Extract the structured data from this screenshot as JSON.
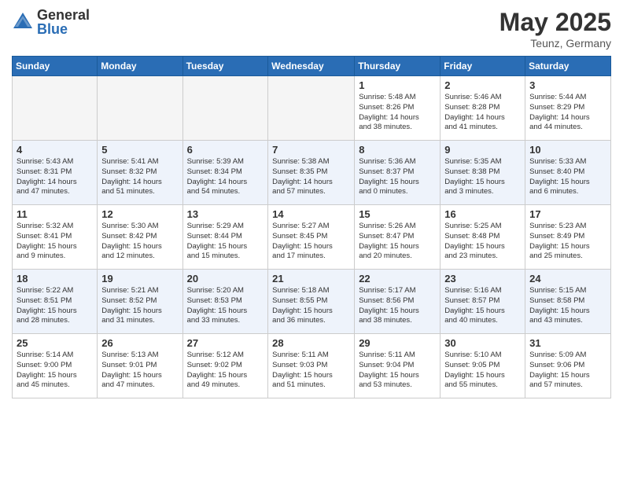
{
  "header": {
    "logo_general": "General",
    "logo_blue": "Blue",
    "month_title": "May 2025",
    "location": "Teunz, Germany"
  },
  "weekdays": [
    "Sunday",
    "Monday",
    "Tuesday",
    "Wednesday",
    "Thursday",
    "Friday",
    "Saturday"
  ],
  "weeks": [
    [
      {
        "day": "",
        "info": ""
      },
      {
        "day": "",
        "info": ""
      },
      {
        "day": "",
        "info": ""
      },
      {
        "day": "",
        "info": ""
      },
      {
        "day": "1",
        "info": "Sunrise: 5:48 AM\nSunset: 8:26 PM\nDaylight: 14 hours\nand 38 minutes."
      },
      {
        "day": "2",
        "info": "Sunrise: 5:46 AM\nSunset: 8:28 PM\nDaylight: 14 hours\nand 41 minutes."
      },
      {
        "day": "3",
        "info": "Sunrise: 5:44 AM\nSunset: 8:29 PM\nDaylight: 14 hours\nand 44 minutes."
      }
    ],
    [
      {
        "day": "4",
        "info": "Sunrise: 5:43 AM\nSunset: 8:31 PM\nDaylight: 14 hours\nand 47 minutes."
      },
      {
        "day": "5",
        "info": "Sunrise: 5:41 AM\nSunset: 8:32 PM\nDaylight: 14 hours\nand 51 minutes."
      },
      {
        "day": "6",
        "info": "Sunrise: 5:39 AM\nSunset: 8:34 PM\nDaylight: 14 hours\nand 54 minutes."
      },
      {
        "day": "7",
        "info": "Sunrise: 5:38 AM\nSunset: 8:35 PM\nDaylight: 14 hours\nand 57 minutes."
      },
      {
        "day": "8",
        "info": "Sunrise: 5:36 AM\nSunset: 8:37 PM\nDaylight: 15 hours\nand 0 minutes."
      },
      {
        "day": "9",
        "info": "Sunrise: 5:35 AM\nSunset: 8:38 PM\nDaylight: 15 hours\nand 3 minutes."
      },
      {
        "day": "10",
        "info": "Sunrise: 5:33 AM\nSunset: 8:40 PM\nDaylight: 15 hours\nand 6 minutes."
      }
    ],
    [
      {
        "day": "11",
        "info": "Sunrise: 5:32 AM\nSunset: 8:41 PM\nDaylight: 15 hours\nand 9 minutes."
      },
      {
        "day": "12",
        "info": "Sunrise: 5:30 AM\nSunset: 8:42 PM\nDaylight: 15 hours\nand 12 minutes."
      },
      {
        "day": "13",
        "info": "Sunrise: 5:29 AM\nSunset: 8:44 PM\nDaylight: 15 hours\nand 15 minutes."
      },
      {
        "day": "14",
        "info": "Sunrise: 5:27 AM\nSunset: 8:45 PM\nDaylight: 15 hours\nand 17 minutes."
      },
      {
        "day": "15",
        "info": "Sunrise: 5:26 AM\nSunset: 8:47 PM\nDaylight: 15 hours\nand 20 minutes."
      },
      {
        "day": "16",
        "info": "Sunrise: 5:25 AM\nSunset: 8:48 PM\nDaylight: 15 hours\nand 23 minutes."
      },
      {
        "day": "17",
        "info": "Sunrise: 5:23 AM\nSunset: 8:49 PM\nDaylight: 15 hours\nand 25 minutes."
      }
    ],
    [
      {
        "day": "18",
        "info": "Sunrise: 5:22 AM\nSunset: 8:51 PM\nDaylight: 15 hours\nand 28 minutes."
      },
      {
        "day": "19",
        "info": "Sunrise: 5:21 AM\nSunset: 8:52 PM\nDaylight: 15 hours\nand 31 minutes."
      },
      {
        "day": "20",
        "info": "Sunrise: 5:20 AM\nSunset: 8:53 PM\nDaylight: 15 hours\nand 33 minutes."
      },
      {
        "day": "21",
        "info": "Sunrise: 5:18 AM\nSunset: 8:55 PM\nDaylight: 15 hours\nand 36 minutes."
      },
      {
        "day": "22",
        "info": "Sunrise: 5:17 AM\nSunset: 8:56 PM\nDaylight: 15 hours\nand 38 minutes."
      },
      {
        "day": "23",
        "info": "Sunrise: 5:16 AM\nSunset: 8:57 PM\nDaylight: 15 hours\nand 40 minutes."
      },
      {
        "day": "24",
        "info": "Sunrise: 5:15 AM\nSunset: 8:58 PM\nDaylight: 15 hours\nand 43 minutes."
      }
    ],
    [
      {
        "day": "25",
        "info": "Sunrise: 5:14 AM\nSunset: 9:00 PM\nDaylight: 15 hours\nand 45 minutes."
      },
      {
        "day": "26",
        "info": "Sunrise: 5:13 AM\nSunset: 9:01 PM\nDaylight: 15 hours\nand 47 minutes."
      },
      {
        "day": "27",
        "info": "Sunrise: 5:12 AM\nSunset: 9:02 PM\nDaylight: 15 hours\nand 49 minutes."
      },
      {
        "day": "28",
        "info": "Sunrise: 5:11 AM\nSunset: 9:03 PM\nDaylight: 15 hours\nand 51 minutes."
      },
      {
        "day": "29",
        "info": "Sunrise: 5:11 AM\nSunset: 9:04 PM\nDaylight: 15 hours\nand 53 minutes."
      },
      {
        "day": "30",
        "info": "Sunrise: 5:10 AM\nSunset: 9:05 PM\nDaylight: 15 hours\nand 55 minutes."
      },
      {
        "day": "31",
        "info": "Sunrise: 5:09 AM\nSunset: 9:06 PM\nDaylight: 15 hours\nand 57 minutes."
      }
    ]
  ]
}
